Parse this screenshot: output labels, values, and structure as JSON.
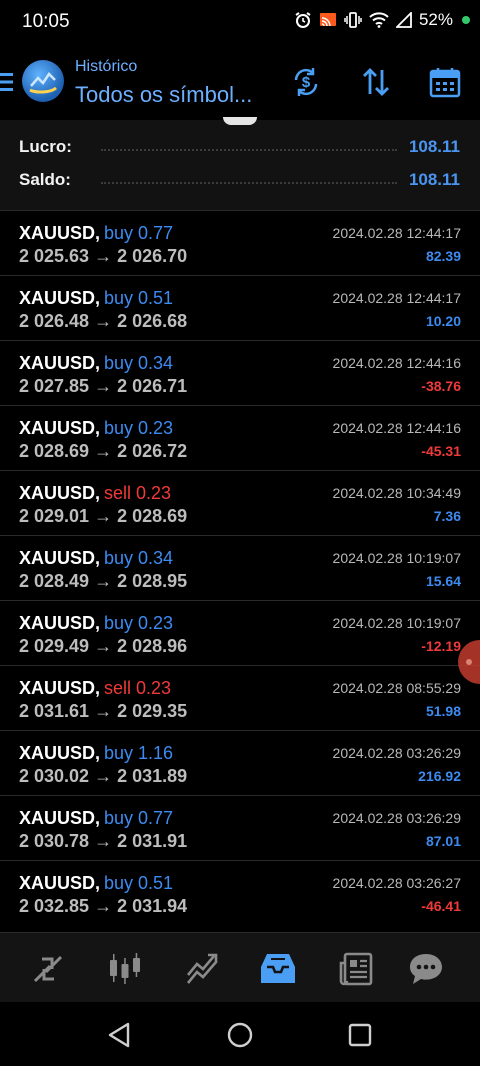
{
  "status_bar": {
    "time": "10:05",
    "battery": "52%"
  },
  "header": {
    "title": "Histórico",
    "subtitle": "Todos os símbol..."
  },
  "summary": [
    {
      "label": "Lucro:",
      "value": "108.11"
    },
    {
      "label": "Saldo:",
      "value": "108.11"
    }
  ],
  "trades": [
    {
      "symbol": "XAUUSD,",
      "side": "buy",
      "volume": "buy 0.77",
      "prices": "2 025.63 → 2 026.70",
      "time": "2024.02.28 12:44:17",
      "profit": "82.39",
      "profit_sign": "pos"
    },
    {
      "symbol": "XAUUSD,",
      "side": "buy",
      "volume": "buy 0.51",
      "prices": "2 026.48 → 2 026.68",
      "time": "2024.02.28 12:44:17",
      "profit": "10.20",
      "profit_sign": "pos"
    },
    {
      "symbol": "XAUUSD,",
      "side": "buy",
      "volume": "buy 0.34",
      "prices": "2 027.85 → 2 026.71",
      "time": "2024.02.28 12:44:16",
      "profit": "-38.76",
      "profit_sign": "neg"
    },
    {
      "symbol": "XAUUSD,",
      "side": "buy",
      "volume": "buy 0.23",
      "prices": "2 028.69 → 2 026.72",
      "time": "2024.02.28 12:44:16",
      "profit": "-45.31",
      "profit_sign": "neg"
    },
    {
      "symbol": "XAUUSD,",
      "side": "sell",
      "volume": "sell 0.23",
      "prices": "2 029.01 → 2 028.69",
      "time": "2024.02.28 10:34:49",
      "profit": "7.36",
      "profit_sign": "pos"
    },
    {
      "symbol": "XAUUSD,",
      "side": "buy",
      "volume": "buy 0.34",
      "prices": "2 028.49 → 2 028.95",
      "time": "2024.02.28 10:19:07",
      "profit": "15.64",
      "profit_sign": "pos"
    },
    {
      "symbol": "XAUUSD,",
      "side": "buy",
      "volume": "buy 0.23",
      "prices": "2 029.49 → 2 028.96",
      "time": "2024.02.28 10:19:07",
      "profit": "-12.19",
      "profit_sign": "neg"
    },
    {
      "symbol": "XAUUSD,",
      "side": "sell",
      "volume": "sell 0.23",
      "prices": "2 031.61 → 2 029.35",
      "time": "2024.02.28 08:55:29",
      "profit": "51.98",
      "profit_sign": "pos"
    },
    {
      "symbol": "XAUUSD,",
      "side": "buy",
      "volume": "buy 1.16",
      "prices": "2 030.02 → 2 031.89",
      "time": "2024.02.28 03:26:29",
      "profit": "216.92",
      "profit_sign": "pos"
    },
    {
      "symbol": "XAUUSD,",
      "side": "buy",
      "volume": "buy 0.77",
      "prices": "2 030.78 → 2 031.91",
      "time": "2024.02.28 03:26:29",
      "profit": "87.01",
      "profit_sign": "pos"
    },
    {
      "symbol": "XAUUSD,",
      "side": "buy",
      "volume": "buy 0.51",
      "prices": "2 032.85 → 2 031.94",
      "time": "2024.02.28 03:26:27",
      "profit": "-46.41",
      "profit_sign": "neg"
    }
  ],
  "bottom_nav": [
    {
      "icon": "quotes-icon",
      "active": false
    },
    {
      "icon": "chart-icon",
      "active": false
    },
    {
      "icon": "trade-icon",
      "active": false
    },
    {
      "icon": "history-icon",
      "active": true
    },
    {
      "icon": "news-icon",
      "active": false
    },
    {
      "icon": "chat-icon",
      "active": false
    }
  ],
  "colors": {
    "accent": "#3d8af0",
    "loss": "#f03a3a",
    "background": "#000000",
    "nav_active": "#4a9ff5",
    "nav_inactive": "#8a8a8a"
  }
}
